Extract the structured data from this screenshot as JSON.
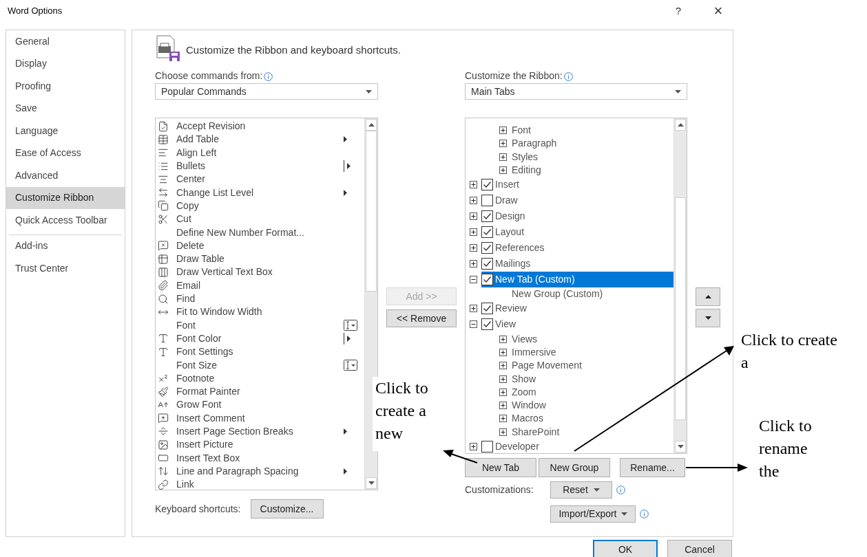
{
  "window": {
    "title": "Word Options",
    "help": "?",
    "close": "×"
  },
  "sidebar": {
    "sections": [
      [
        {
          "label": "General",
          "selected": false
        },
        {
          "label": "Display",
          "selected": false
        },
        {
          "label": "Proofing",
          "selected": false
        },
        {
          "label": "Save",
          "selected": false
        },
        {
          "label": "Language",
          "selected": false
        },
        {
          "label": "Ease of Access",
          "selected": false
        },
        {
          "label": "Advanced",
          "selected": false
        },
        {
          "label": "Customize Ribbon",
          "selected": true
        },
        {
          "label": "Quick Access Toolbar",
          "selected": false
        }
      ],
      [
        {
          "label": "Add-ins",
          "selected": false
        },
        {
          "label": "Trust Center",
          "selected": false
        }
      ]
    ]
  },
  "header": "Customize the Ribbon and keyboard shortcuts.",
  "commands": {
    "label": "Choose commands from:",
    "value": "Popular Commands",
    "items": [
      {
        "label": "Accept Revision",
        "kind": "plain"
      },
      {
        "label": "Add Table",
        "kind": "submenu"
      },
      {
        "label": "Align Left",
        "kind": "plain"
      },
      {
        "label": "Bullets",
        "kind": "split"
      },
      {
        "label": "Center",
        "kind": "plain"
      },
      {
        "label": "Change List Level",
        "kind": "submenu"
      },
      {
        "label": "Copy",
        "kind": "plain"
      },
      {
        "label": "Cut",
        "kind": "plain"
      },
      {
        "label": "Define New Number Format...",
        "kind": "plain"
      },
      {
        "label": "Delete",
        "kind": "plain"
      },
      {
        "label": "Draw Table",
        "kind": "plain"
      },
      {
        "label": "Draw Vertical Text Box",
        "kind": "plain"
      },
      {
        "label": "Email",
        "kind": "plain"
      },
      {
        "label": "Find",
        "kind": "plain"
      },
      {
        "label": "Fit to Window Width",
        "kind": "plain"
      },
      {
        "label": "Font",
        "kind": "font-box"
      },
      {
        "label": "Font Color",
        "kind": "split"
      },
      {
        "label": "Font Settings",
        "kind": "plain"
      },
      {
        "label": "Font Size",
        "kind": "font-box"
      },
      {
        "label": "Footnote",
        "kind": "plain"
      },
      {
        "label": "Format Painter",
        "kind": "plain"
      },
      {
        "label": "Grow Font",
        "kind": "plain"
      },
      {
        "label": "Insert Comment",
        "kind": "plain"
      },
      {
        "label": "Insert Page  Section Breaks",
        "kind": "submenu"
      },
      {
        "label": "Insert Picture",
        "kind": "plain"
      },
      {
        "label": "Insert Text Box",
        "kind": "plain"
      },
      {
        "label": "Line and Paragraph Spacing",
        "kind": "submenu"
      },
      {
        "label": "Link",
        "kind": "plain"
      }
    ]
  },
  "transfer": {
    "add": {
      "label": "Add >>",
      "disabled": true
    },
    "remove": {
      "label": "<< Remove",
      "disabled": false
    }
  },
  "ribbon": {
    "label": "Customize the Ribbon:",
    "value": "Main Tabs",
    "tree": [
      {
        "kind": "partial",
        "children": [
          {
            "kind": "group",
            "label": "Font",
            "expanded": false,
            "selected": false
          },
          {
            "kind": "group",
            "label": "Paragraph",
            "expanded": false,
            "selected": false
          },
          {
            "kind": "group",
            "label": "Styles",
            "expanded": false,
            "selected": false
          },
          {
            "kind": "group",
            "label": "Editing",
            "expanded": false,
            "selected": false
          }
        ]
      },
      {
        "kind": "tab",
        "label": "Insert",
        "checked": true,
        "expanded": false,
        "selected": false
      },
      {
        "kind": "tab",
        "label": "Draw",
        "checked": false,
        "expanded": false,
        "selected": false
      },
      {
        "kind": "tab",
        "label": "Design",
        "checked": true,
        "expanded": false,
        "selected": false
      },
      {
        "kind": "tab",
        "label": "Layout",
        "checked": true,
        "expanded": false,
        "selected": false
      },
      {
        "kind": "tab",
        "label": "References",
        "checked": true,
        "expanded": false,
        "selected": false
      },
      {
        "kind": "tab",
        "label": "Mailings",
        "checked": true,
        "expanded": false,
        "selected": false
      },
      {
        "kind": "tab",
        "label": "New Tab (Custom)",
        "checked": true,
        "expanded": true,
        "selected": true,
        "children": [
          {
            "kind": "custom-group",
            "label": "New Group (Custom)",
            "selected": false
          }
        ]
      },
      {
        "kind": "tab",
        "label": "Review",
        "checked": true,
        "expanded": false,
        "selected": false
      },
      {
        "kind": "tab",
        "label": "View",
        "checked": true,
        "expanded": true,
        "selected": false,
        "children": [
          {
            "kind": "group",
            "label": "Views",
            "expanded": false,
            "selected": false
          },
          {
            "kind": "group",
            "label": "Immersive",
            "expanded": false,
            "selected": false
          },
          {
            "kind": "group",
            "label": "Page Movement",
            "expanded": false,
            "selected": false
          },
          {
            "kind": "group",
            "label": "Show",
            "expanded": false,
            "selected": false
          },
          {
            "kind": "group",
            "label": "Zoom",
            "expanded": false,
            "selected": false
          },
          {
            "kind": "group",
            "label": "Window",
            "expanded": false,
            "selected": false
          },
          {
            "kind": "group",
            "label": "Macros",
            "expanded": false,
            "selected": false
          },
          {
            "kind": "group",
            "label": "SharePoint",
            "expanded": false,
            "selected": false
          }
        ]
      },
      {
        "kind": "tab",
        "label": "Developer",
        "checked": false,
        "expanded": false,
        "selected": false
      }
    ]
  },
  "tree_buttons": [
    "New Tab",
    "New Group",
    "Rename..."
  ],
  "customizations": {
    "label": "Customizations:",
    "reset": "Reset",
    "import_export": "Import/Export"
  },
  "keyboard": {
    "label": "Keyboard shortcuts:",
    "button": "Customize..."
  },
  "footer": {
    "ok": "OK",
    "cancel": "Cancel"
  },
  "annotations": [
    {
      "text": "Click to create a new"
    },
    {
      "text": "Click to create a"
    },
    {
      "text": "Click to rename the"
    }
  ]
}
